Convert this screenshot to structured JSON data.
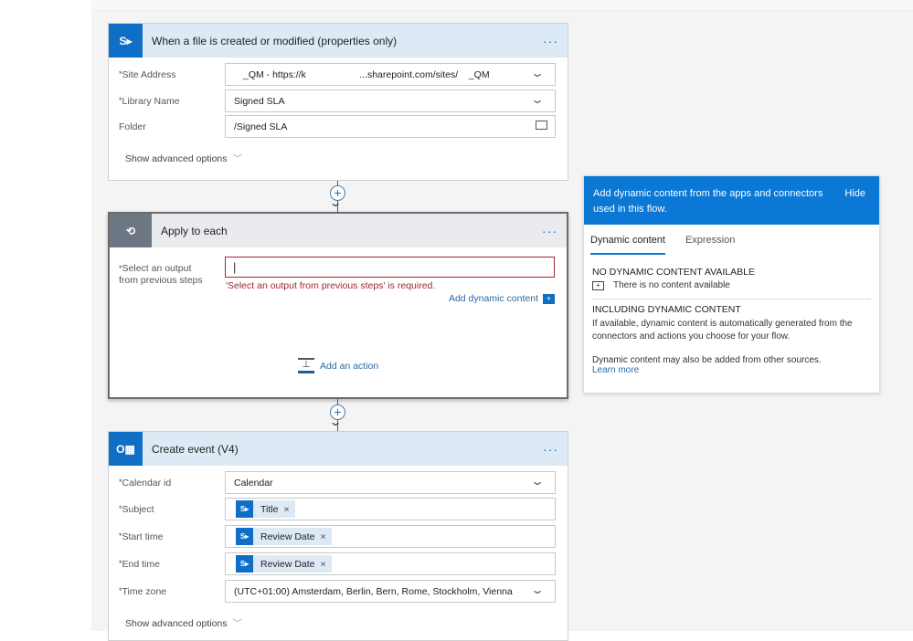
{
  "trigger": {
    "title": "When a file is created or modified (properties only)",
    "icon": "sharepoint-icon",
    "fields": [
      {
        "label": "Site Address",
        "required": true,
        "value": "_QM - https://k                    ...sharepoint.com/sites/    _QM"
      },
      {
        "label": "Library Name",
        "required": true,
        "value": "Signed SLA"
      },
      {
        "label": "Folder",
        "required": false,
        "value": "/Signed SLA"
      }
    ],
    "advanced": "Show advanced options"
  },
  "apply": {
    "title": "Apply to each",
    "label": "Select an output from previous steps",
    "error": "'Select an output from previous steps' is required.",
    "add_dynamic": "Add dynamic content",
    "add_action": "Add an action"
  },
  "event": {
    "title": "Create event (V4)",
    "icon": "outlook-icon",
    "fields": [
      {
        "label": "Calendar id",
        "value": "Calendar"
      },
      {
        "label": "Subject",
        "token": "Title"
      },
      {
        "label": "Start time",
        "token": "Review Date"
      },
      {
        "label": "End time",
        "token": "Review Date"
      },
      {
        "label": "Time zone",
        "value": "(UTC+01:00) Amsterdam, Berlin, Bern, Rome, Stockholm, Vienna"
      }
    ],
    "advanced": "Show advanced options"
  },
  "panel": {
    "header": "Add dynamic content from the apps and connectors used in this flow.",
    "hide": "Hide",
    "tabs": [
      "Dynamic content",
      "Expression"
    ],
    "no_content_heading": "NO DYNAMIC CONTENT AVAILABLE",
    "no_content_text": "There is no content available",
    "including_heading": "INCLUDING DYNAMIC CONTENT",
    "including_text": "If available, dynamic content is automatically generated from the connectors and actions you choose for your flow.",
    "other_sources": "Dynamic content may also be added from other sources.",
    "learn_more": "Learn more"
  },
  "colors": {
    "accent": "#0078d4",
    "error": "#a4262c"
  }
}
